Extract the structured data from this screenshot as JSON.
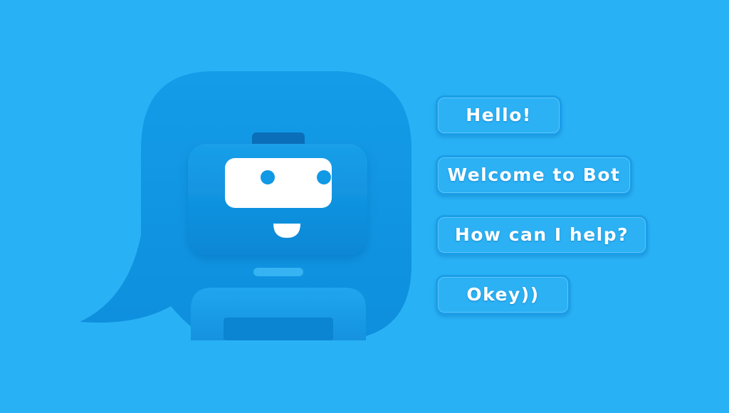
{
  "chat": {
    "messages": [
      {
        "text": "Hello!"
      },
      {
        "text": "Welcome to Bot"
      },
      {
        "text": "How can I help?"
      },
      {
        "text": "Okey))"
      }
    ]
  },
  "colors": {
    "background": "#29b1f5",
    "bubble": "#1199e6",
    "bubble_shade": "#0e8ed9",
    "face_panel": "#0b8fe0",
    "screen": "#ffffff",
    "eyes": "#1199e6"
  },
  "icons": {
    "robot": "chatbot-robot-icon",
    "speech_bubble": "speech-bubble-icon"
  }
}
